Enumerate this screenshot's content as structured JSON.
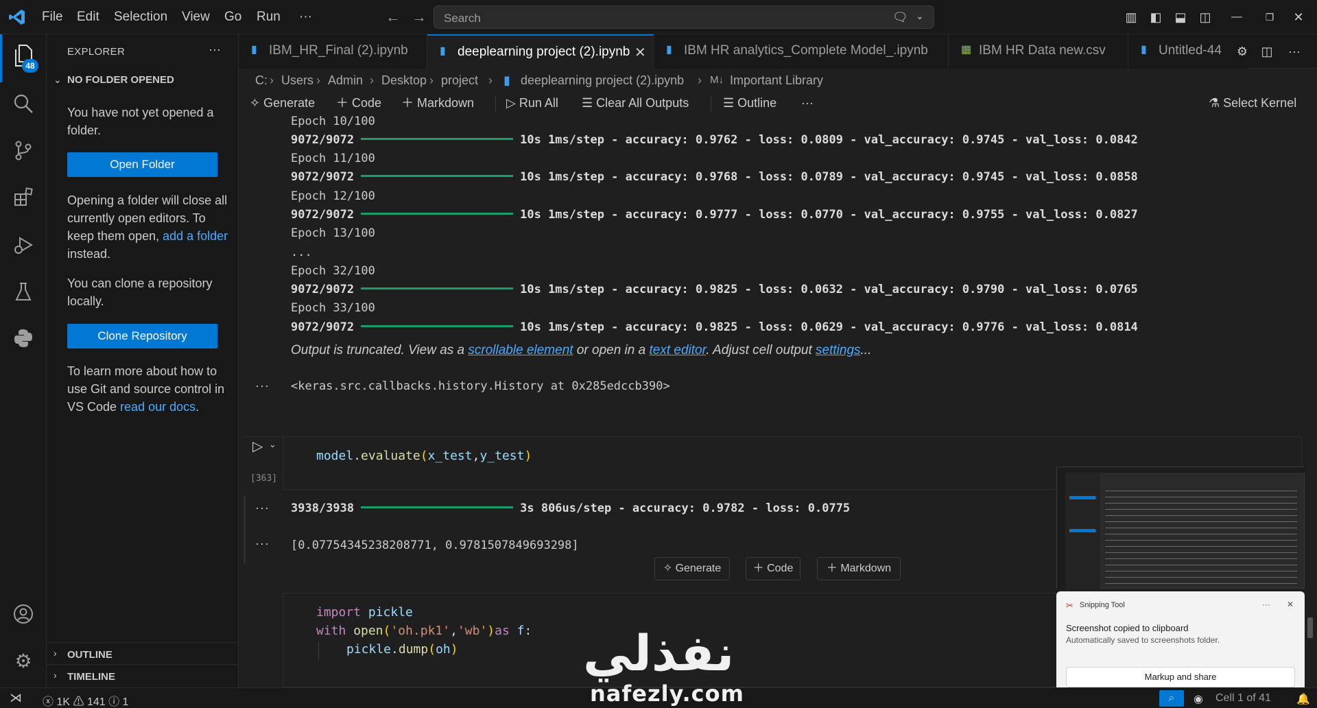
{
  "titlebar": {
    "menu": [
      "File",
      "Edit",
      "Selection",
      "View",
      "Go",
      "Run",
      "···"
    ],
    "search_placeholder": "Search"
  },
  "activity": {
    "explorer_badge": "48"
  },
  "sidebar": {
    "title": "EXPLORER",
    "more": "···",
    "section": "NO FOLDER OPENED",
    "msg_open": "You have not yet opened a folder.",
    "open_button": "Open Folder",
    "msg_close_a": "Opening a folder will close all currently open editors. To keep them open, ",
    "msg_close_link": "add a folder",
    "msg_close_b": " instead.",
    "msg_clone": "You can clone a repository locally.",
    "clone_button": "Clone Repository",
    "msg_git_a": "To learn more about how to use Git and source control in VS Code ",
    "msg_git_link": "read our docs",
    "msg_git_b": ".",
    "outline": "OUTLINE",
    "timeline": "TIMELINE"
  },
  "tabs": [
    {
      "label": "IBM_HR_Final (2).ipynb",
      "icon": "notebook-icon"
    },
    {
      "label": "deeplearning project (2).ipynb",
      "icon": "notebook-icon",
      "active": true
    },
    {
      "label": "IBM HR analytics_Complete Model_.ipynb",
      "icon": "notebook-icon"
    },
    {
      "label": "IBM HR Data new.csv",
      "icon": "csv-icon"
    },
    {
      "label": "Untitled-44",
      "icon": "notebook-icon"
    }
  ],
  "breadcrumb": [
    "C:",
    "Users",
    "Admin",
    "Desktop",
    "project",
    "deeplearning project  (2).ipynb",
    "Important Library"
  ],
  "nb_toolbar": {
    "generate": "Generate",
    "code": "Code",
    "markdown": "Markdown",
    "run_all": "Run All",
    "clear_all": "Clear All Outputs",
    "outline": "Outline",
    "more": "···",
    "select_kernel": "Select Kernel"
  },
  "training_output": [
    {
      "text": "Epoch 10/100",
      "bold": false
    },
    {
      "step": "9072/9072",
      "text": "10s 1ms/step - accuracy: 0.9762 - loss: 0.0809 - val_accuracy: 0.9745 - val_loss: 0.0842"
    },
    {
      "text": "Epoch 11/100",
      "bold": false
    },
    {
      "step": "9072/9072",
      "text": "10s 1ms/step - accuracy: 0.9768 - loss: 0.0789 - val_accuracy: 0.9745 - val_loss: 0.0858"
    },
    {
      "text": "Epoch 12/100",
      "bold": false
    },
    {
      "step": "9072/9072",
      "text": "10s 1ms/step - accuracy: 0.9777 - loss: 0.0770 - val_accuracy: 0.9755 - val_loss: 0.0827"
    },
    {
      "text": "Epoch 13/100",
      "bold": false
    },
    {
      "text": "...",
      "bold": false
    },
    {
      "text": "Epoch 32/100",
      "bold": false
    },
    {
      "step": "9072/9072",
      "text": "10s 1ms/step - accuracy: 0.9825 - loss: 0.0632 - val_accuracy: 0.9790 - val_loss: 0.0765"
    },
    {
      "text": "Epoch 33/100",
      "bold": false
    },
    {
      "step": "9072/9072",
      "text": "10s 1ms/step - accuracy: 0.9825 - loss: 0.0629 - val_accuracy: 0.9776 - val_loss: 0.0814"
    }
  ],
  "truncated": {
    "a": "Output is truncated. View as a ",
    "link1": "scrollable element",
    "b": " or open in a ",
    "link2": "text editor",
    "c": ". Adjust cell output ",
    "link3": "settings",
    "d": "..."
  },
  "history_output": "<keras.src.callbacks.history.History at 0x285edccb390>",
  "eval_cell": {
    "exec_count": "[363]",
    "code_obj": "model",
    "code_dot": ".",
    "code_fn": "evaluate",
    "code_open": "(",
    "code_a": "x_test",
    "code_comma": ",",
    "code_b": "y_test",
    "code_close": ")",
    "out_step": "3938/3938",
    "out_text": "3s 806us/step - accuracy: 0.9782 - loss: 0.0775",
    "out_result": "[0.07754345238208771, 0.9781507849693298]"
  },
  "insert": {
    "generate": "Generate",
    "code": "Code",
    "markdown": "Markdown"
  },
  "pickle_cell": {
    "l1_kw": "import",
    "l1_mod": " pickle",
    "l2_kw": "with",
    "l2_fn": " open",
    "l2_p1": "(",
    "l2_s1": "'oh.pk1'",
    "l2_c": ",",
    "l2_s2": "'wb'",
    "l2_p2": ")",
    "l2_as": "as",
    "l2_f": " f",
    "l2_colon": ":",
    "l3_mod": "pickle",
    "l3_dot": ".",
    "l3_fn": "dump",
    "l3_p1": "(",
    "l3_arg": "oh",
    "l3_p2": ")"
  },
  "statusbar": {
    "errors": "1K",
    "warnings": "141",
    "info": "1",
    "cell": "Cell 1 of 41"
  },
  "toast": {
    "app": "Snipping Tool",
    "more": "···",
    "title": "Screenshot copied to clipboard",
    "body": "Automatically saved to screenshots folder.",
    "button": "Markup and share"
  },
  "watermark": {
    "arabic": "نفذلي",
    "latin": "nafezly.com"
  },
  "colors": {
    "accent": "#0078d4",
    "progress": "#18a06a",
    "link": "#4daafc"
  }
}
